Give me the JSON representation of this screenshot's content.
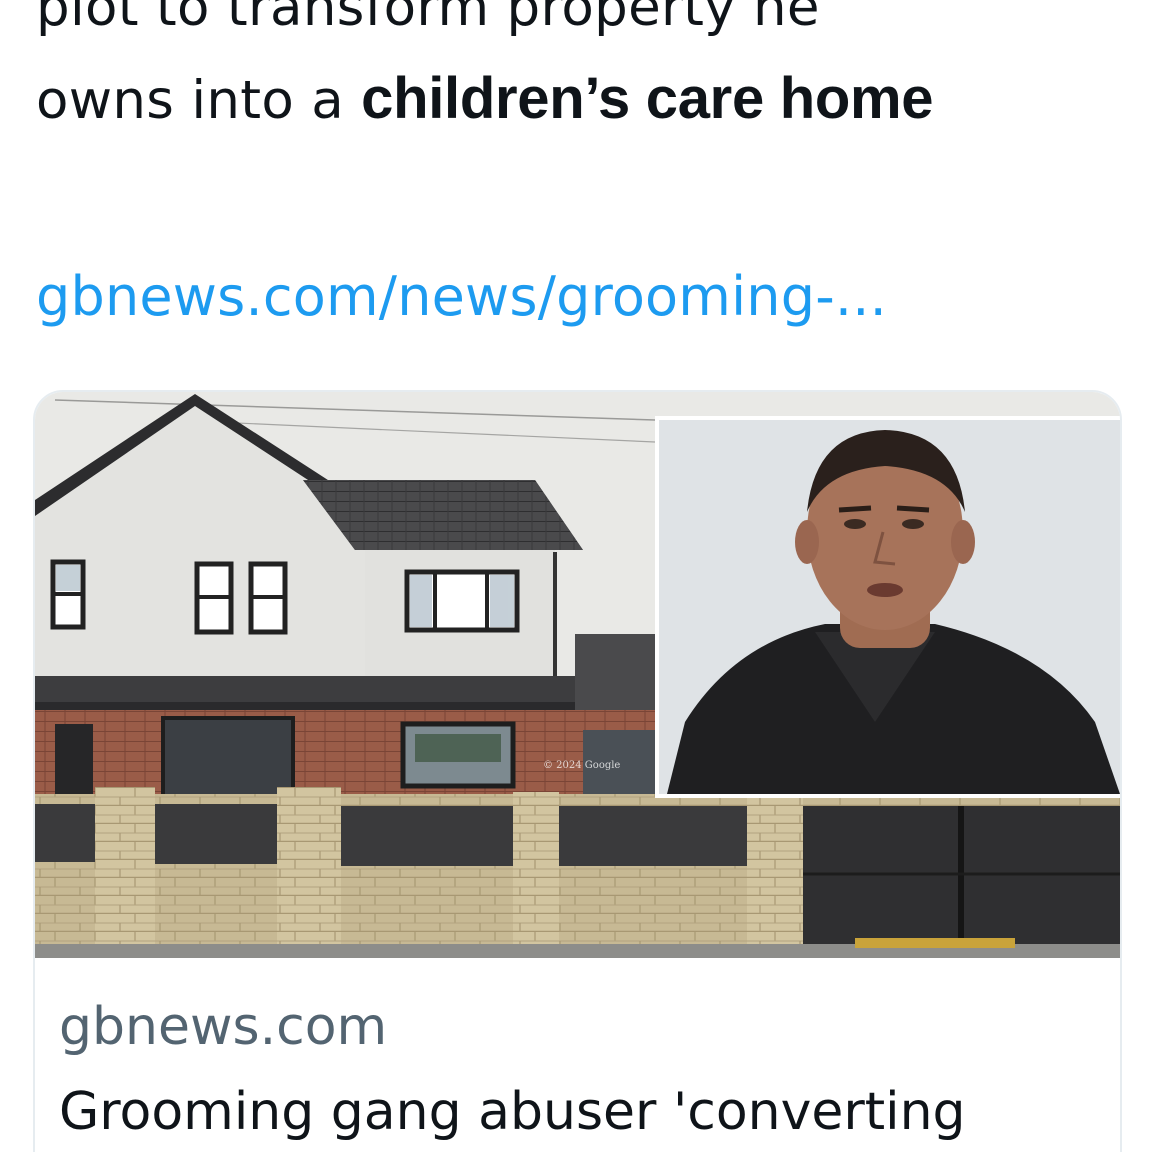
{
  "tweet": {
    "line1": "plot to transform property he",
    "line2_regular": "owns into a ",
    "line2_bold": "children’s care home",
    "link": "gbnews.com/news/grooming-..."
  },
  "card": {
    "domain": "gbnews.com",
    "title": "Grooming gang abuser 'converting",
    "image_watermark": "© 2024 Google"
  },
  "colors": {
    "text": "#0f1419",
    "link": "#1d9bf0",
    "muted": "#536471",
    "card_border": "#e6ecf0"
  }
}
